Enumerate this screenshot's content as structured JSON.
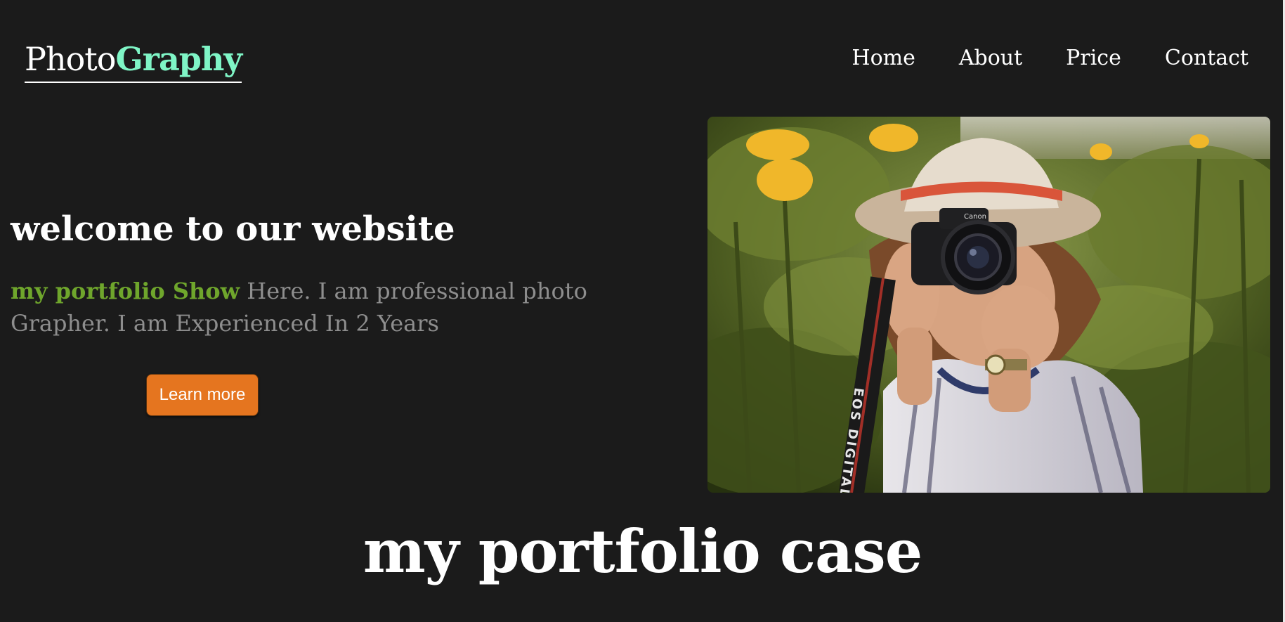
{
  "header": {
    "logo": {
      "part1": "Photo",
      "part2": "Graphy"
    },
    "nav": [
      {
        "label": "Home"
      },
      {
        "label": "About"
      },
      {
        "label": "Price"
      },
      {
        "label": "Contact"
      }
    ]
  },
  "hero": {
    "title": "welcome to our website",
    "text_accent": "my portfolio Show",
    "text_rest": " Here. I am professional photo Grapher. I am Experienced In 2 Years",
    "button_label": "Learn more",
    "image_alt": "Photographer with camera in sunflower field",
    "camera_strap_text": "EOS DIGITAL",
    "camera_brand": "Canon"
  },
  "portfolio": {
    "title": "my portfolio case"
  },
  "colors": {
    "background": "#1b1b1b",
    "logo_accent": "#7ff5c6",
    "text_accent": "#6fa62c",
    "button": "#e5751f",
    "body_text": "#8e8e8e"
  }
}
